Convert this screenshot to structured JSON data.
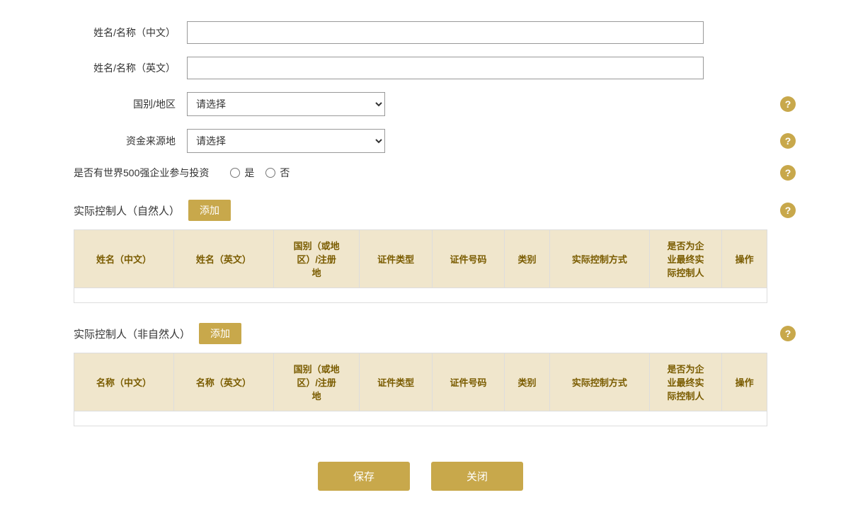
{
  "form": {
    "name_cn_label": "姓名/名称（中文）",
    "name_en_label": "姓名/名称（英文）",
    "country_label": "国别/地区",
    "fund_source_label": "资金来源地",
    "fortune500_label": "是否有世界500强企业参与投资",
    "select_placeholder": "请选择",
    "radio_yes": "是",
    "radio_no": "否",
    "section1_title": "实际控制人（自然人）",
    "section2_title": "实际控制人（非自然人）",
    "add_label": "添加",
    "table1_headers": [
      "姓名（中文）",
      "姓名（英文）",
      "国别（或地\n区）/注册\n地",
      "证件类型",
      "证件号码",
      "类别",
      "实际控制方式",
      "是否为企\n业最终实\n际控制人",
      "操作"
    ],
    "table2_headers": [
      "名称（中文）",
      "名称（英文）",
      "国别（或地\n区）/注册\n地",
      "证件类型",
      "证件号码",
      "类别",
      "实际控制方式",
      "是否为企\n业最终实\n际控制人",
      "操作"
    ],
    "save_label": "保存",
    "close_label": "关闭",
    "help_icon": "?"
  }
}
